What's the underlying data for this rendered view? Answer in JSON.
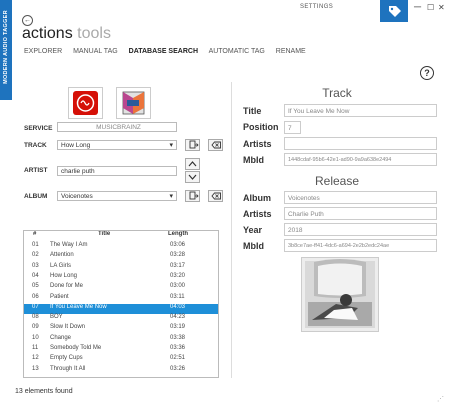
{
  "window": {
    "title": "SETTINGS",
    "minimize": "─",
    "restore": "☐",
    "close": "✕"
  },
  "ribbon": {
    "text": "MODERN AUDIO TAGGER"
  },
  "header": {
    "title_main": "actions",
    "title_sub": "tools"
  },
  "nav": {
    "tabs": [
      "EXPLORER",
      "MANUAL TAG",
      "DATABASE SEARCH",
      "AUTOMATIC TAG",
      "RENAME"
    ],
    "active": "DATABASE SEARCH"
  },
  "help": "?",
  "search": {
    "service_label": "SERVICE",
    "service_value": "MUSICBRAINZ",
    "track_label": "TRACK",
    "track_value": "How Long",
    "artist_label": "ARTIST",
    "artist_value": "charlie puth",
    "album_label": "ALBUM",
    "album_value": "Voicenotes"
  },
  "table": {
    "headers": {
      "num": "#",
      "title": "Title",
      "length": "Length"
    },
    "rows": [
      {
        "num": "01",
        "title": "The Way I Am",
        "length": "03:06"
      },
      {
        "num": "02",
        "title": "Attention",
        "length": "03:28"
      },
      {
        "num": "03",
        "title": "LA Girls",
        "length": "03:17"
      },
      {
        "num": "04",
        "title": "How Long",
        "length": "03:20"
      },
      {
        "num": "05",
        "title": "Done for Me",
        "length": "03:00"
      },
      {
        "num": "06",
        "title": "Patient",
        "length": "03:11"
      },
      {
        "num": "07",
        "title": "If You Leave Me Now",
        "length": "04:03"
      },
      {
        "num": "08",
        "title": "BOY",
        "length": "04:23"
      },
      {
        "num": "09",
        "title": "Slow It Down",
        "length": "03:19"
      },
      {
        "num": "10",
        "title": "Change",
        "length": "03:38"
      },
      {
        "num": "11",
        "title": "Somebody Told Me",
        "length": "03:36"
      },
      {
        "num": "12",
        "title": "Empty Cups",
        "length": "02:51"
      },
      {
        "num": "13",
        "title": "Through It All",
        "length": "03:26"
      }
    ],
    "selected": "07"
  },
  "track": {
    "heading": "Track",
    "title_label": "Title",
    "title_value": "If You Leave Me Now",
    "position_label": "Position",
    "position_value": "7",
    "artists_label": "Artists",
    "artists_value": "",
    "mbid_label": "MbId",
    "mbid_value": "1448cdaf-95b6-42e1-ad90-9a9a638e2494"
  },
  "release": {
    "heading": "Release",
    "album_label": "Album",
    "album_value": "Voicenotes",
    "artists_label": "Artists",
    "artists_value": "Charlie Puth",
    "year_label": "Year",
    "year_value": "2018",
    "mbid_label": "MbId",
    "mbid_value": "3b8ce7ae-ff41-4dc6-a694-2e2b2edc24ae"
  },
  "status": {
    "text": "13 elements found"
  },
  "colors": {
    "accent": "#1e73be",
    "selection": "#1e8fd8"
  }
}
